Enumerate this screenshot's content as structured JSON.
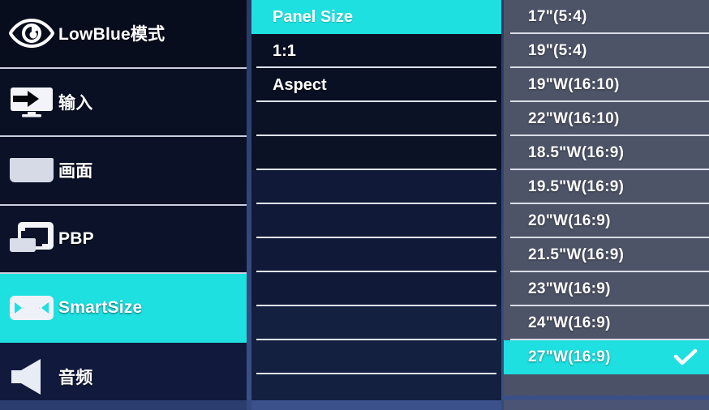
{
  "menu": {
    "sidebar": {
      "items": [
        {
          "label": "LowBlue模式",
          "icon": "eye-icon",
          "active": false
        },
        {
          "label": "输入",
          "icon": "input-monitor-icon",
          "active": false
        },
        {
          "label": "画面",
          "icon": "picture-screen-icon",
          "active": false
        },
        {
          "label": "PBP",
          "icon": "pbp-dual-screen-icon",
          "active": false
        },
        {
          "label": "SmartSize",
          "icon": "smartsize-arrows-icon",
          "active": true
        },
        {
          "label": "音频",
          "icon": "speaker-icon",
          "active": false
        }
      ]
    },
    "middle": {
      "header": "Panel Size",
      "items": [
        {
          "label": "1:1"
        },
        {
          "label": "Aspect"
        },
        {
          "label": ""
        },
        {
          "label": ""
        },
        {
          "label": ""
        },
        {
          "label": ""
        },
        {
          "label": ""
        },
        {
          "label": ""
        },
        {
          "label": ""
        },
        {
          "label": ""
        },
        {
          "label": ""
        }
      ]
    },
    "right": {
      "items": [
        {
          "label": "17\"(5:4)",
          "selected": false
        },
        {
          "label": "19\"(5:4)",
          "selected": false
        },
        {
          "label": "19\"W(16:10)",
          "selected": false
        },
        {
          "label": "22\"W(16:10)",
          "selected": false
        },
        {
          "label": "18.5\"W(16:9)",
          "selected": false
        },
        {
          "label": "19.5\"W(16:9)",
          "selected": false
        },
        {
          "label": "20\"W(16:9)",
          "selected": false
        },
        {
          "label": "21.5\"W(16:9)",
          "selected": false
        },
        {
          "label": "23\"W(16:9)",
          "selected": false
        },
        {
          "label": "24\"W(16:9)",
          "selected": false
        },
        {
          "label": "27\"W(16:9)",
          "selected": true,
          "check": "check-icon"
        }
      ]
    },
    "colors": {
      "highlight": "#1fe0e0",
      "sidebar_bg": "#0b1024",
      "middle_bg": "#0f1733",
      "right_bg": "#4e5468",
      "separator": "#dfe4f0",
      "text": "#ffffff"
    }
  }
}
